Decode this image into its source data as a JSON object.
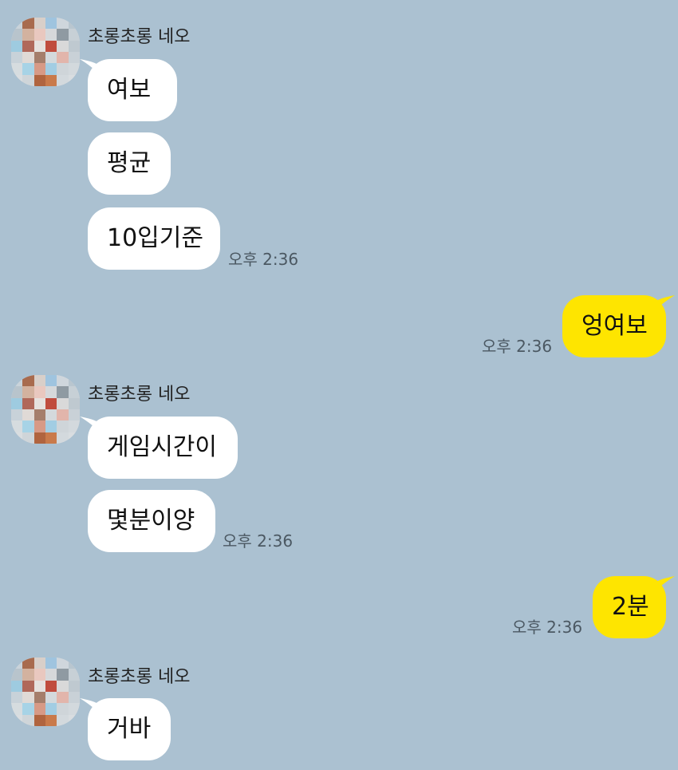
{
  "chat": {
    "sender_name": "초롱초롱 네오",
    "groups": [
      {
        "sender": "초롱초롱 네오",
        "messages": [
          "여보",
          "평균",
          "10입기준"
        ],
        "time": "오후 2:36"
      },
      {
        "me": true,
        "messages": [
          "엉여보"
        ],
        "time": "오후 2:36"
      },
      {
        "sender": "초롱초롱 네오",
        "messages": [
          "게임시간이",
          "몇분이양"
        ],
        "time": "오후 2:36"
      },
      {
        "me": true,
        "messages": [
          "2분"
        ],
        "time": "오후 2:36"
      },
      {
        "sender": "초롱초롱 네오",
        "messages": [
          "거바"
        ]
      }
    ]
  },
  "colors": {
    "background": "#abc1d1",
    "incoming_bubble": "#ffffff",
    "outgoing_bubble": "#fee500",
    "timestamp": "#4b5862"
  }
}
